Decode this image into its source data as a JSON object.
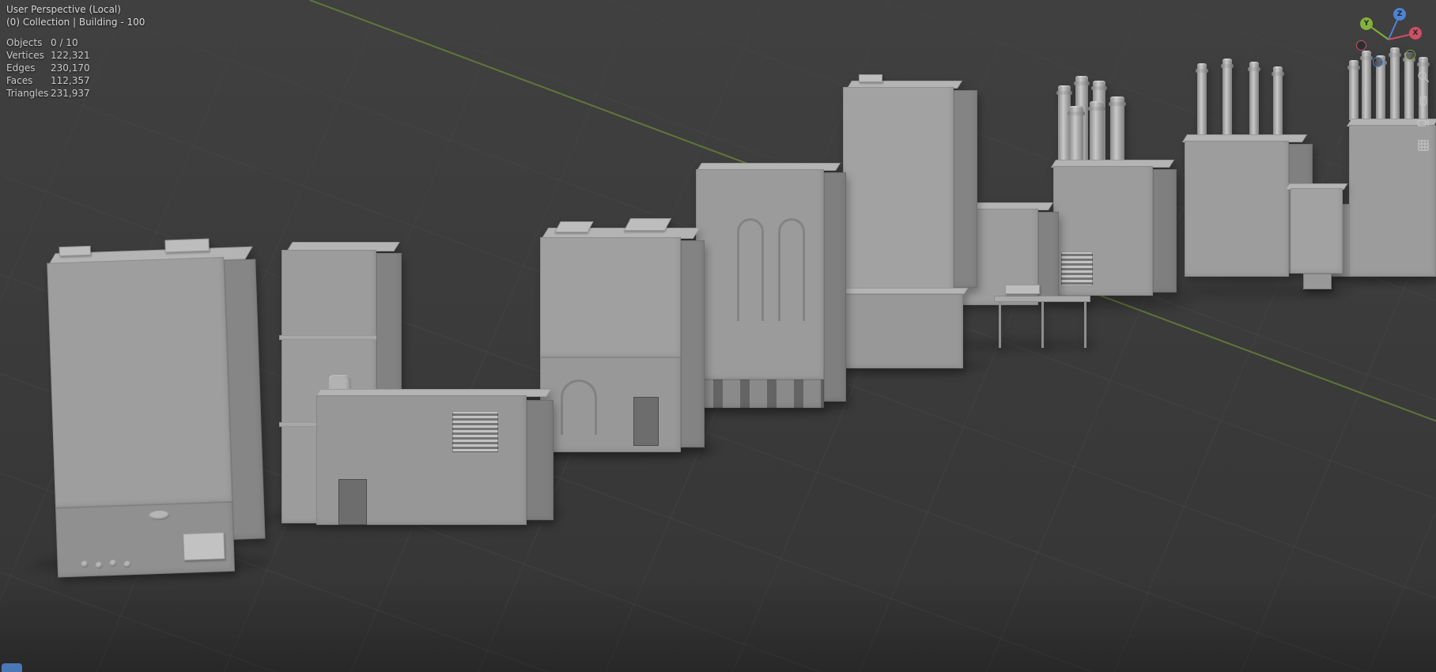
{
  "viewport": {
    "perspective_label": "User Perspective (Local)",
    "collection_label": "(0) Collection | Building - 100"
  },
  "stats": {
    "rows": [
      {
        "label": "Objects",
        "value": "0 / 10"
      },
      {
        "label": "Vertices",
        "value": "122,321"
      },
      {
        "label": "Edges",
        "value": "230,170"
      },
      {
        "label": "Faces",
        "value": "112,357"
      },
      {
        "label": "Triangles",
        "value": "231,937"
      }
    ]
  },
  "gizmo": {
    "x_label": "X",
    "y_label": "Y",
    "z_label": "Z"
  },
  "icons": {
    "gizmo": "navigation-gizmo",
    "zoom": "zoom-icon",
    "pan": "pan-hand-icon",
    "camera": "camera-view-icon",
    "perspective": "perspective-grid-icon"
  },
  "colors": {
    "viewport_background": "#3b3b3b",
    "grid_line": "#474747",
    "y_axis_green": "#66803a",
    "building_gray": "#9e9e9e",
    "gizmo_x_red": "#d04f63",
    "gizmo_y_green": "#84b23a",
    "gizmo_z_blue": "#4e83d1",
    "fragment_blue": "#4b77b6"
  }
}
